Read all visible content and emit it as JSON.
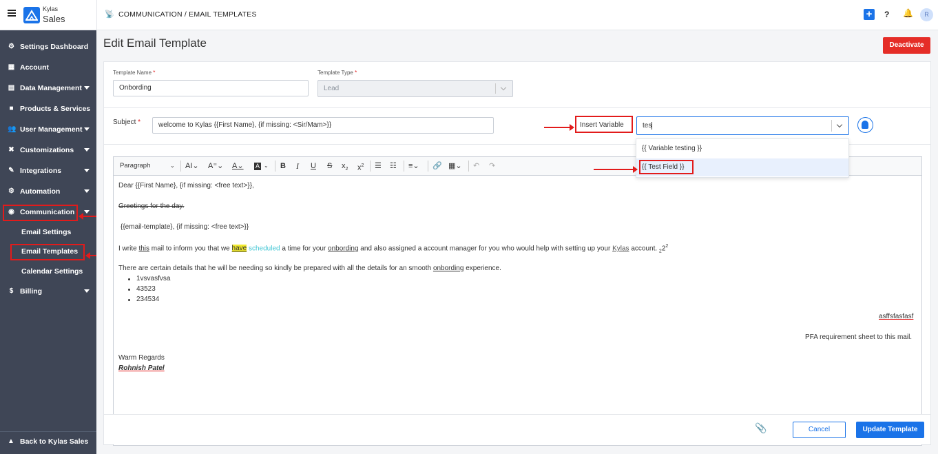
{
  "topbar": {
    "brand_top": "Kylas",
    "brand_bottom": "Sales",
    "breadcrumb": "COMMUNICATION / EMAIL TEMPLATES",
    "help": "?",
    "avatar": "R",
    "plus": "+"
  },
  "sidebar": {
    "items": [
      {
        "label": "Settings Dashboard",
        "icon": "gear-icon"
      },
      {
        "label": "Account",
        "icon": "building-icon"
      },
      {
        "label": "Data Management",
        "icon": "table-icon"
      },
      {
        "label": "Products & Services",
        "icon": "box-icon"
      },
      {
        "label": "User Management",
        "icon": "users-icon"
      },
      {
        "label": "Customizations",
        "icon": "tools-icon"
      },
      {
        "label": "Integrations",
        "icon": "plug-icon"
      },
      {
        "label": "Automation",
        "icon": "cogs-icon"
      },
      {
        "label": "Communication",
        "icon": "satellite-icon"
      },
      {
        "label": "Billing",
        "icon": "dollar-icon"
      }
    ],
    "sub_items": [
      "Email Settings",
      "Email Templates",
      "Calendar Settings"
    ],
    "back": "Back to Kylas Sales"
  },
  "page": {
    "title": "Edit Email Template",
    "deactivate": "Deactivate"
  },
  "form": {
    "template_name_label": "Template Name",
    "template_name_value": "Onbording",
    "template_type_label": "Template Type",
    "template_type_value": "Lead",
    "subject_label": "Subject",
    "subject_value": "welcome to Kylas {{First Name}, {if missing: <Sir/Mam>}}",
    "insert_variable": "Insert Variable",
    "variable_search": "tes",
    "variable_options": [
      "{{ Variable testing }}",
      "{{ Test Field }}"
    ]
  },
  "editor": {
    "paragraph": "Paragraph",
    "lines": {
      "l1": "Dear {{First Name}, {if missing: <free text>}},",
      "l2": "Greetings for the day.",
      "l3": "{{email-template}, {if missing: <free text>}}",
      "l4a": "I write ",
      "l4b": "this",
      "l4c": " mail to inform you that we ",
      "l4d": "have",
      "l4e": "scheduled",
      "l4f": " a time for your ",
      "l4g": "onbording",
      "l4h": " and also assigned a account manager for you who would help with setting up your ",
      "l4i": "Kylas",
      "l4j": " account. ",
      "l4k": "2",
      "l4l": "2",
      "l4m": "2",
      "l5a": "There are certain details that he will be needing so kindly be prepared with all the details for an smooth ",
      "l5b": "onbording",
      "l5c": " experience.",
      "bullets": [
        "1vsvasfvsa",
        "43523",
        "234534"
      ],
      "right1": "asffsfasfasf",
      "right2": "PFA requirement sheet to this mail.",
      "regards": "Warm Regards",
      "signature": "Rohnish Patel"
    }
  },
  "footer": {
    "cancel": "Cancel",
    "update": "Update Template"
  },
  "colors": {
    "sidebar": "#3f4656",
    "primary": "#1a73e8",
    "danger": "#e52d27",
    "annotation": "#e21b1b"
  }
}
